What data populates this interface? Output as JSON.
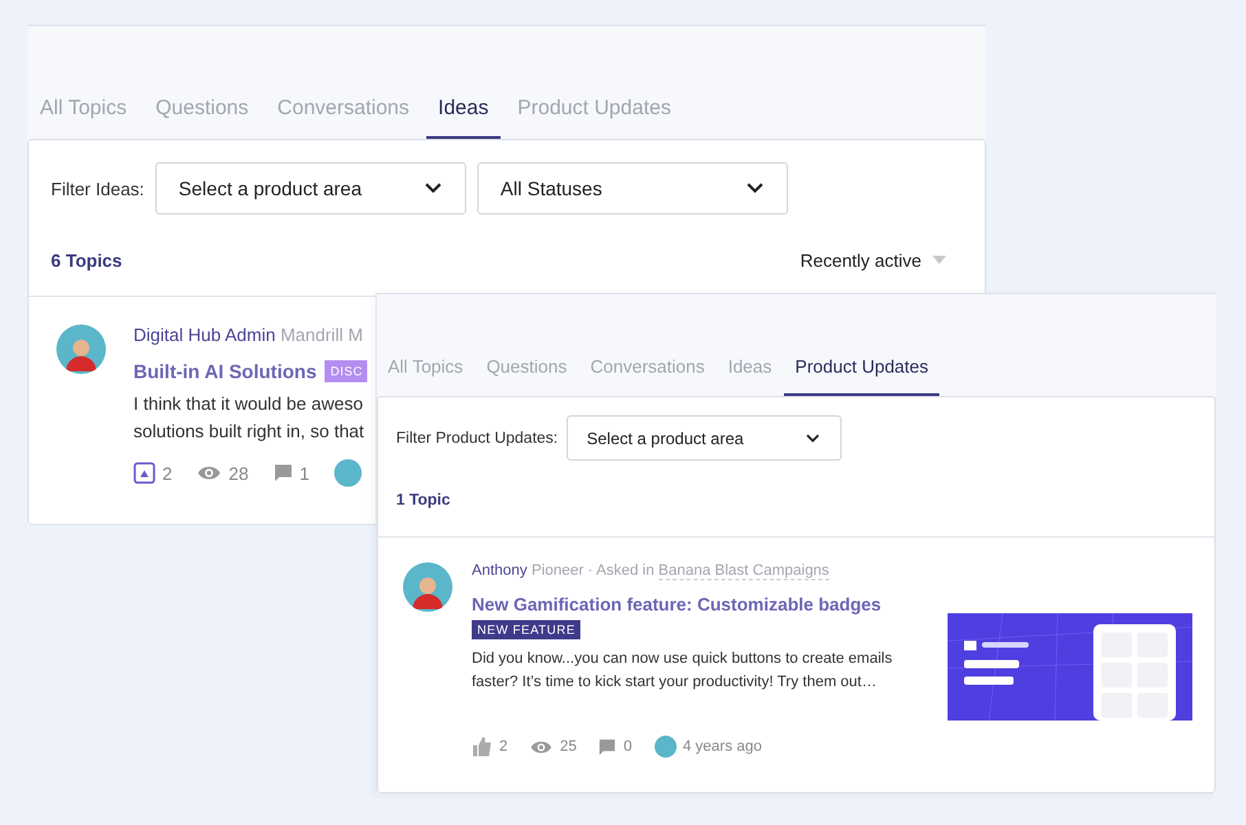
{
  "back_panel": {
    "tabs": [
      {
        "label": "All Topics",
        "selected": false
      },
      {
        "label": "Questions",
        "selected": false
      },
      {
        "label": "Conversations",
        "selected": false
      },
      {
        "label": "Ideas",
        "selected": true
      },
      {
        "label": "Product Updates",
        "selected": false
      }
    ],
    "filter_label": "Filter Ideas:",
    "dropdowns": [
      {
        "value": "Select a product area"
      },
      {
        "value": "All Statuses"
      }
    ],
    "topic_count": "6 Topics",
    "sort": "Recently active",
    "post": {
      "author": "Digital Hub Admin",
      "role": "Mandrill M",
      "title": "Built-in AI Solutions",
      "badge": "DISC",
      "excerpt_lines": [
        "I think that it would be aweso",
        "solutions built right in, so that"
      ],
      "votes": "2",
      "views": "28",
      "comments": "1"
    }
  },
  "front_panel": {
    "tabs": [
      {
        "label": "All Topics",
        "selected": false
      },
      {
        "label": "Questions",
        "selected": false
      },
      {
        "label": "Conversations",
        "selected": false
      },
      {
        "label": "Ideas",
        "selected": false
      },
      {
        "label": "Product Updates",
        "selected": true
      }
    ],
    "filter_label": "Filter Product Updates:",
    "dropdowns": [
      {
        "value": "Select a product area"
      }
    ],
    "topic_count": "1 Topic",
    "post": {
      "author": "Anthony",
      "role": "Pioneer",
      "asked_in": "· Asked in",
      "category": "Banana Blast Campaigns",
      "title": "New Gamification feature: Customizable badges",
      "badge": "NEW FEATURE",
      "excerpt": "Did you know...you can now use quick buttons to create emails faster? It’s time to kick start your productivity! Try them out…",
      "likes": "2",
      "views": "25",
      "comments": "0",
      "time": "4 years ago"
    }
  }
}
